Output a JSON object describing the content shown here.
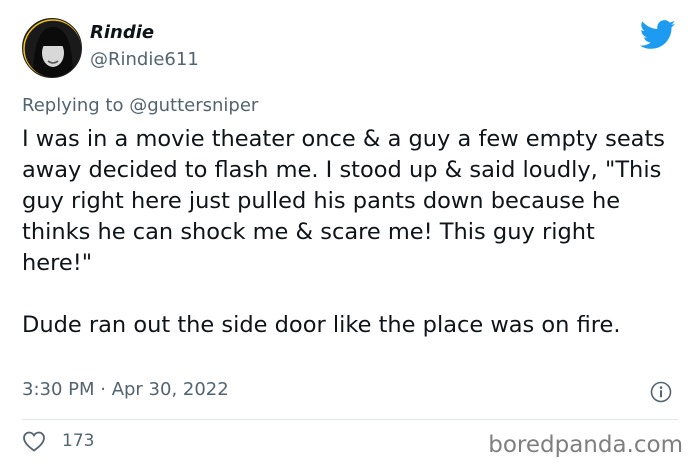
{
  "tweet": {
    "author": {
      "display_name": "Rindie",
      "handle": "@Rindie611",
      "avatar_icon": "profile-photo"
    },
    "reply": {
      "prefix": "Replying to ",
      "mention": "@guttersniper"
    },
    "body_paragraphs": [
      "I was in a movie theater once & a guy a few empty seats away decided to flash me. I stood up & said loudly, \"This guy right here just pulled his pants down because he thinks he can shock me & scare me! This guy right here!\"",
      "Dude ran out the side door like the place was on fire."
    ],
    "timestamp": "3:30 PM · Apr 30, 2022",
    "likes": "173"
  },
  "watermark": "boredpanda.com",
  "icons": {
    "brand": "twitter-bird-icon",
    "info": "info-icon",
    "like": "heart-icon"
  },
  "colors": {
    "twitter_blue": "#1d9bf0",
    "text": "#0f1419",
    "secondary": "#536471",
    "avatar_ring": "#f4c21a"
  }
}
